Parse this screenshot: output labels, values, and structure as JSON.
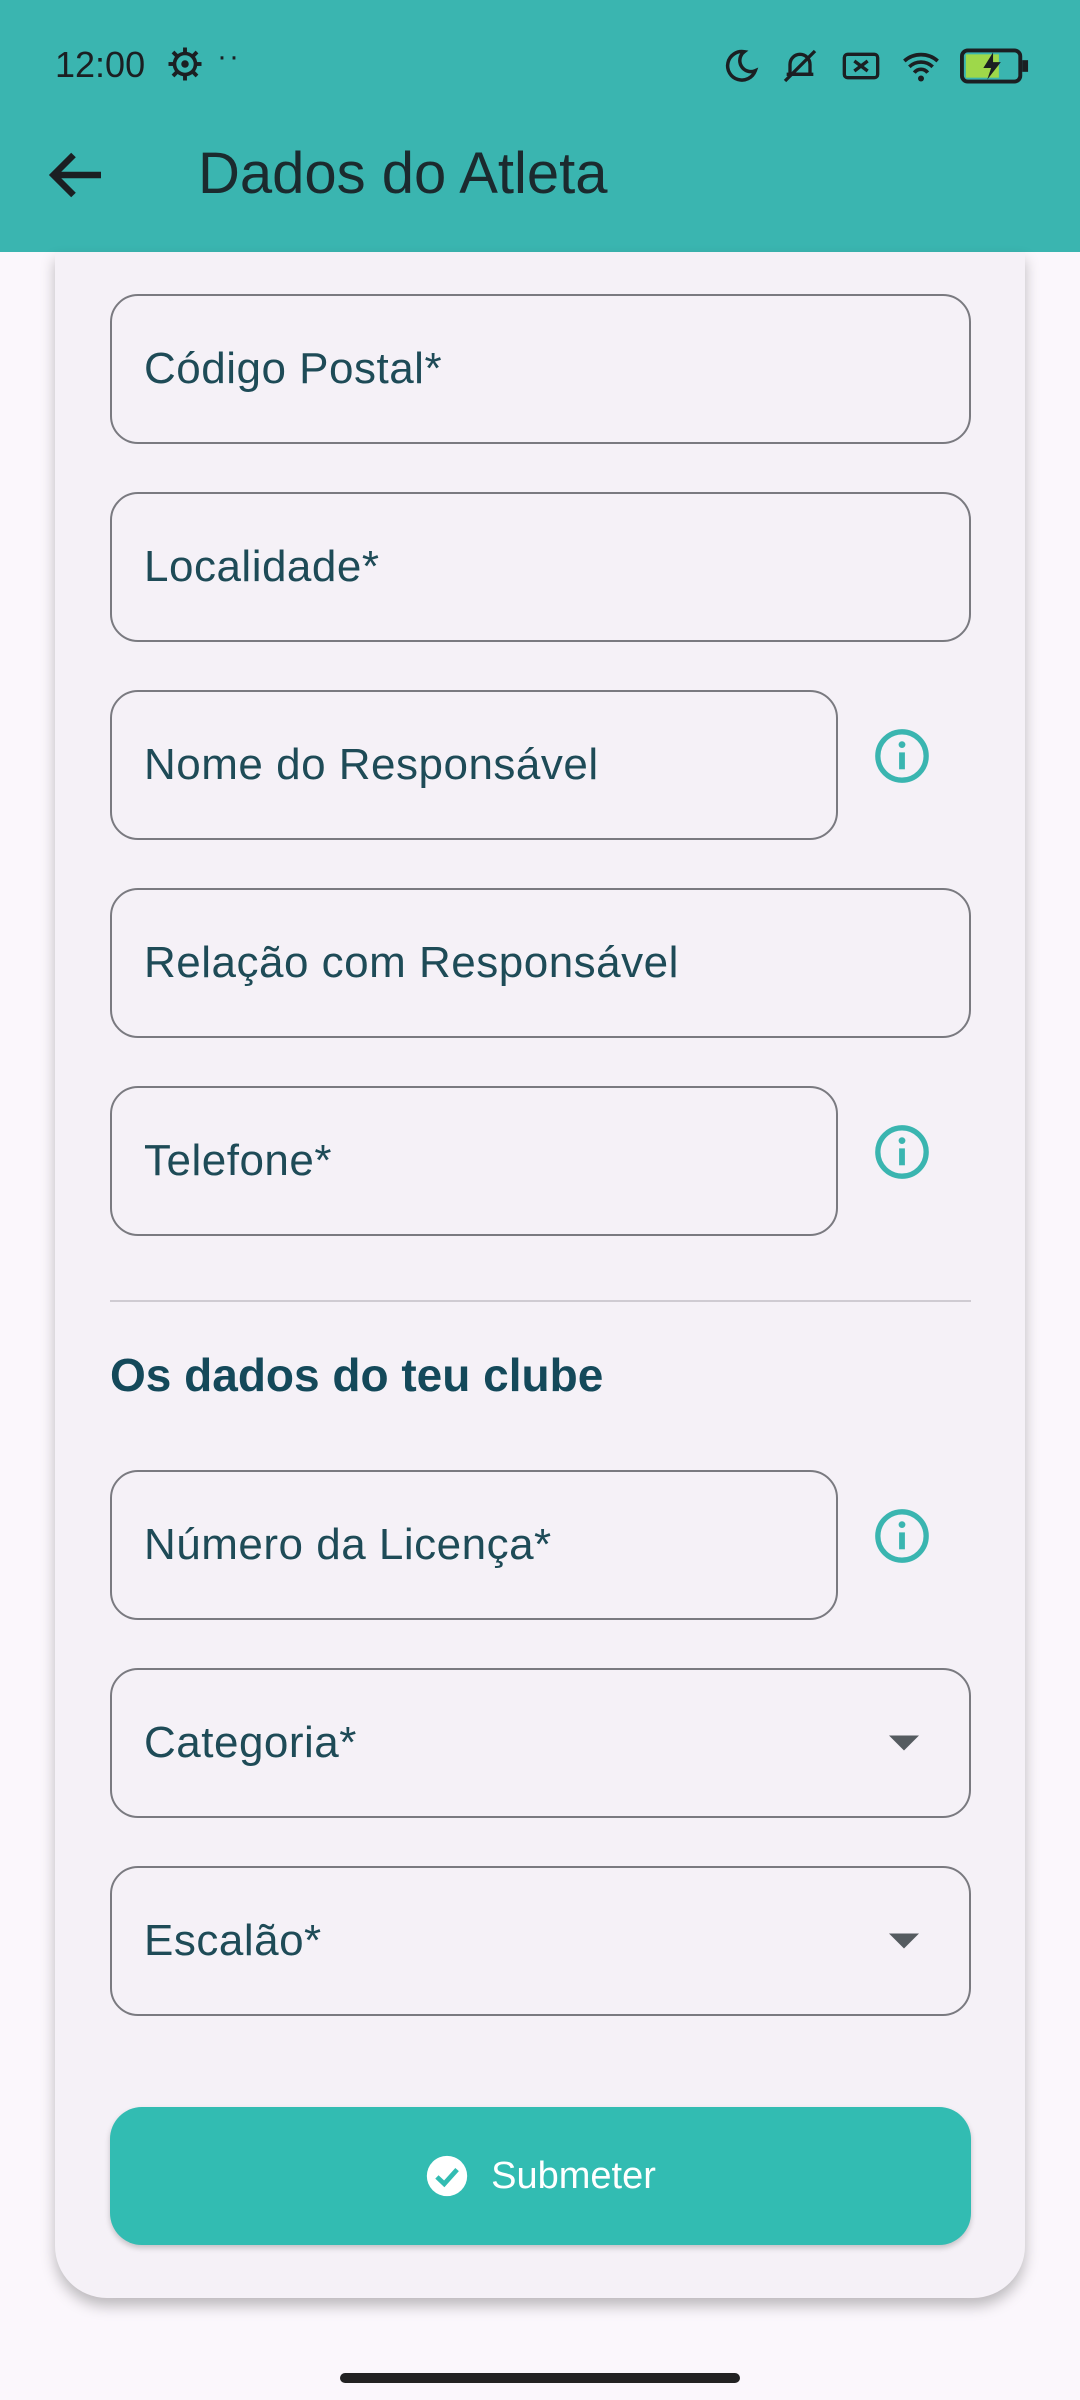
{
  "status_bar": {
    "time": "12:00",
    "dots": "··"
  },
  "header": {
    "title": "Dados do Atleta"
  },
  "fields": {
    "postal_code": "Código Postal*",
    "locality": "Localidade*",
    "guardian_name": "Nome do Responsável",
    "guardian_relation": "Relação com Responsável",
    "phone": "Telefone*",
    "license_number": "Número da Licença*",
    "category": "Categoria*",
    "tier": "Escalão*"
  },
  "section": {
    "club_title": "Os dados do teu clube"
  },
  "submit": {
    "label": "Submeter"
  },
  "colors": {
    "accent": "#3ab5b0",
    "button": "#32bcb2",
    "label": "#1e4b57"
  }
}
